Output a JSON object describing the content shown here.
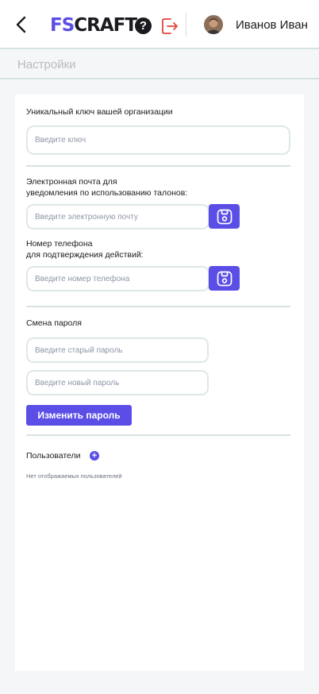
{
  "header": {
    "logo_fs": "FS",
    "logo_craft": "CRAFT",
    "help_glyph": "?",
    "user_name": "Иванов Иван",
    "icons": [
      "back-arrow-icon",
      "help-icon",
      "logout-icon",
      "avatar"
    ]
  },
  "page": {
    "title": "Настройки"
  },
  "settings": {
    "org_key": {
      "label": "Уникальный ключ вашей организации",
      "placeholder": "Введите ключ"
    },
    "email": {
      "label_line1": "Электронная почта для",
      "label_line2": "уведомления по использованию талонов:",
      "placeholder": "Введите электронную почту",
      "save_icon": "save-icon"
    },
    "phone": {
      "label_line1": "Номер телефона",
      "label_line2": "для подтверждения действий:",
      "placeholder": "Введите номер телефона",
      "save_icon": "save-icon"
    },
    "password": {
      "label": "Смена пароля",
      "old_placeholder": "Введите старый пароль",
      "new_placeholder": "Введите новый пароль",
      "button_label": "Изменить пароль"
    },
    "users": {
      "label": "Пользователи",
      "add_glyph": "+",
      "empty_text": "Нет отображаемых пользователей"
    }
  },
  "colors": {
    "accent": "#5a4ee6",
    "logout": "#e0433c",
    "divider": "#d6e4e1",
    "page_bg": "#f4f6f7"
  }
}
